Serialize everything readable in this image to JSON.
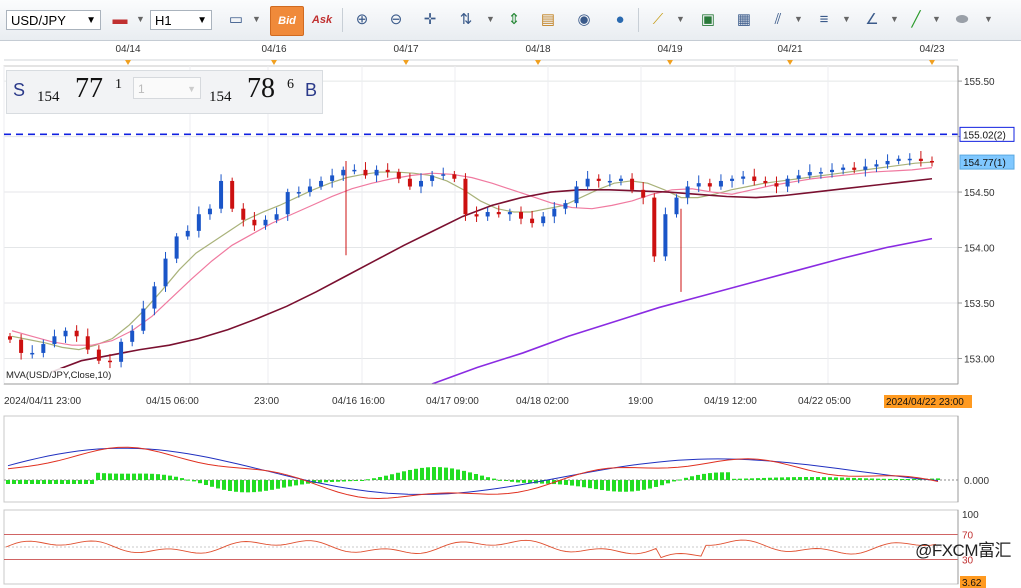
{
  "toolbar": {
    "symbol": "USD/JPY",
    "timeframe": "H1",
    "bid_label": "Bid",
    "ask_label": "Ask"
  },
  "quote": {
    "sell_letter": "S",
    "sell_big": "154",
    "sell_pips": "77",
    "sell_frac": "1",
    "lot": "1",
    "buy_big": "154",
    "buy_pips": "78",
    "buy_frac": "6",
    "buy_letter": "B"
  },
  "indicator_label": "MVA(USD/JPY,Close,10)",
  "current_time_badge": "2024/04/22 23:00",
  "watermark": "@FXCM富汇",
  "colors": {
    "up": "#1a55c8",
    "down": "#cc1010",
    "ma_fast": "#a9b27a",
    "ma_mid": "#f07aa0",
    "ma_slow": "#7a1030",
    "ma_long": "#8a2be2",
    "hline": "#1020e0",
    "price_badge": "#80c8ff",
    "time_badge": "#ff9a20",
    "osc_hist": "#22dd22",
    "macd": "#2030c0",
    "signal": "#e03020",
    "rsi": "#e05030"
  },
  "chart_data": [
    {
      "type": "candlestick",
      "symbol": "USD/JPY",
      "timeframe": "H1",
      "date_markers": [
        "04/14",
        "04/16",
        "04/17",
        "04/18",
        "04/19",
        "04/21",
        "04/23"
      ],
      "x_tick_labels": [
        "2024/04/11 23:00",
        "04/15 06:00",
        "23:00",
        "04/16 16:00",
        "04/17 09:00",
        "04/18 02:00",
        "19:00",
        "04/19 12:00",
        "04/22 05:00"
      ],
      "y_ticks": [
        155.5,
        155.0,
        154.5,
        154.0,
        153.5,
        153.0
      ],
      "ylim": [
        152.77,
        155.6
      ],
      "price_labels": [
        {
          "text": "155.02(2)",
          "value": 155.02
        },
        {
          "text": "154.77(1)",
          "value": 154.77
        }
      ],
      "horizontal_line": 155.02,
      "indicator_label": "MVA(USD/JPY,Close,10)",
      "close_series_approx": [
        153.17,
        153.05,
        153.05,
        153.13,
        153.2,
        153.25,
        153.2,
        153.08,
        152.98,
        152.97,
        153.15,
        153.25,
        153.45,
        153.65,
        153.9,
        154.1,
        154.15,
        154.3,
        154.35,
        154.6,
        154.35,
        154.25,
        154.2,
        154.25,
        154.3,
        154.5,
        154.5,
        154.55,
        154.6,
        154.65,
        154.7,
        154.7,
        154.65,
        154.7,
        154.68,
        154.62,
        154.55,
        154.6,
        154.65,
        154.66,
        154.62,
        154.3,
        154.28,
        154.32,
        154.3,
        154.32,
        154.26,
        154.22,
        154.28,
        154.35,
        154.4,
        154.55,
        154.62,
        154.6,
        154.6,
        154.62,
        154.52,
        154.45,
        153.92,
        154.3,
        154.45,
        154.55,
        154.58,
        154.55,
        154.6,
        154.62,
        154.64,
        154.6,
        154.58,
        154.55,
        154.62,
        154.65,
        154.68,
        154.68,
        154.7,
        154.72,
        154.7,
        154.73,
        154.75,
        154.78,
        154.8,
        154.8,
        154.78,
        154.77
      ],
      "ma_series": [
        {
          "period_label": "fast",
          "values": [
            153.2,
            153.17,
            153.14,
            153.1,
            153.08,
            153.12,
            153.18,
            153.3,
            153.45,
            153.62,
            153.8,
            153.95,
            154.05,
            154.15,
            154.25,
            154.32,
            154.38,
            154.45,
            154.52,
            154.58,
            154.63,
            154.66,
            154.68,
            154.68,
            154.67,
            154.65,
            154.6,
            154.52,
            154.42,
            154.35,
            154.32,
            154.32,
            154.35,
            154.38,
            154.45,
            154.52,
            154.58,
            154.6,
            154.58,
            154.52,
            154.45,
            154.45,
            154.48,
            154.52,
            154.55,
            154.58,
            154.6,
            154.62,
            154.64,
            154.66,
            154.68,
            154.7,
            154.72,
            154.74,
            154.76,
            154.77
          ]
        },
        {
          "period_label": "mid",
          "values": [
            153.25,
            153.2,
            153.15,
            153.12,
            153.12,
            153.16,
            153.25,
            153.38,
            153.55,
            153.72,
            153.88,
            154.02,
            154.12,
            154.22,
            154.3,
            154.38,
            154.46,
            154.53,
            154.58,
            154.62,
            154.65,
            154.67,
            154.66,
            154.63,
            154.58,
            154.52,
            154.46,
            154.4,
            154.36,
            154.35,
            154.38,
            154.42,
            154.48,
            154.52,
            154.53,
            154.5,
            154.48,
            154.52,
            154.56,
            154.59,
            154.62,
            154.64,
            154.66,
            154.68,
            154.69,
            154.7,
            154.72
          ]
        },
        {
          "period_label": "slow",
          "values": [
            152.88,
            152.98,
            153.03,
            153.08,
            153.12,
            153.18,
            153.26,
            153.36,
            153.47,
            153.6,
            153.74,
            153.88,
            154.02,
            154.15,
            154.28,
            154.38,
            154.45,
            154.5,
            154.52,
            154.52,
            154.51,
            154.5,
            154.48,
            154.46,
            154.45,
            154.47,
            154.5,
            154.53,
            154.56,
            154.59,
            154.62
          ]
        },
        {
          "period_label": "long",
          "values": [
            152.77,
            152.92,
            153.05,
            153.2,
            153.33,
            153.46,
            153.57,
            153.68,
            153.79,
            153.9,
            154.0,
            154.08
          ]
        }
      ]
    },
    {
      "type": "histogram_line",
      "name": "oscillator",
      "y_tick_labels": [
        "0.000"
      ],
      "zero_line": 0.0
    },
    {
      "type": "line",
      "name": "rsi_panel",
      "y_tick_labels": [
        "100",
        "70",
        "30",
        "3.62"
      ],
      "levels": [
        70,
        30
      ],
      "ylim": [
        0,
        100
      ],
      "current_value_label": "3.62"
    }
  ]
}
